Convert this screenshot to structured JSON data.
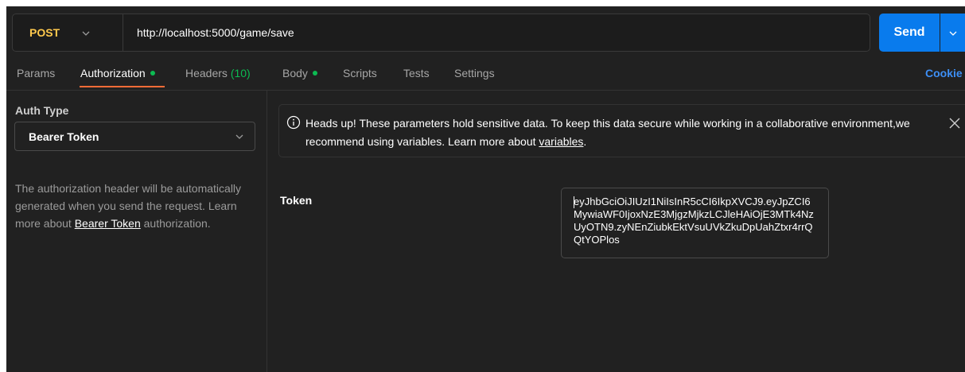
{
  "request": {
    "method": "POST",
    "url": "http://localhost:5000/game/save",
    "send_label": "Send"
  },
  "tabs": [
    {
      "label": "Params"
    },
    {
      "label": "Authorization",
      "active": true,
      "dot": true
    },
    {
      "label": "Headers",
      "count": "(10)"
    },
    {
      "label": "Body",
      "dot": true
    },
    {
      "label": "Scripts"
    },
    {
      "label": "Tests"
    },
    {
      "label": "Settings"
    }
  ],
  "cookies_label": "Cookie",
  "auth": {
    "type_label": "Auth Type",
    "selected": "Bearer Token",
    "desc_before": "The authorization header will be automatically generated when you send the request. Learn more about ",
    "desc_link": "Bearer Token",
    "desc_after": " authorization."
  },
  "banner": {
    "text_before": "Heads up! These parameters hold sensitive data. To keep this data secure while working in a collaborative environment,we recommend using variables. Learn more about ",
    "link": "variables",
    "text_after": "."
  },
  "token": {
    "label": "Token",
    "value": "eyJhbGciOiJIUzI1NiIsInR5cCI6IkpXVCJ9.eyJpZCI6MywiaWF0IjoxNzE3MjgzMjkzLCJleHAiOjE3MTk4NzUyOTN9.zyNEnZiubkEktVsuUVkZkuDpUahZtxr4rrQQtYOPlos"
  },
  "colors": {
    "method": "#ffc94d",
    "send": "#097bed",
    "active_underline": "#ff6c37",
    "dot": "#0cbb52",
    "cookies": "#3d8ff5"
  }
}
